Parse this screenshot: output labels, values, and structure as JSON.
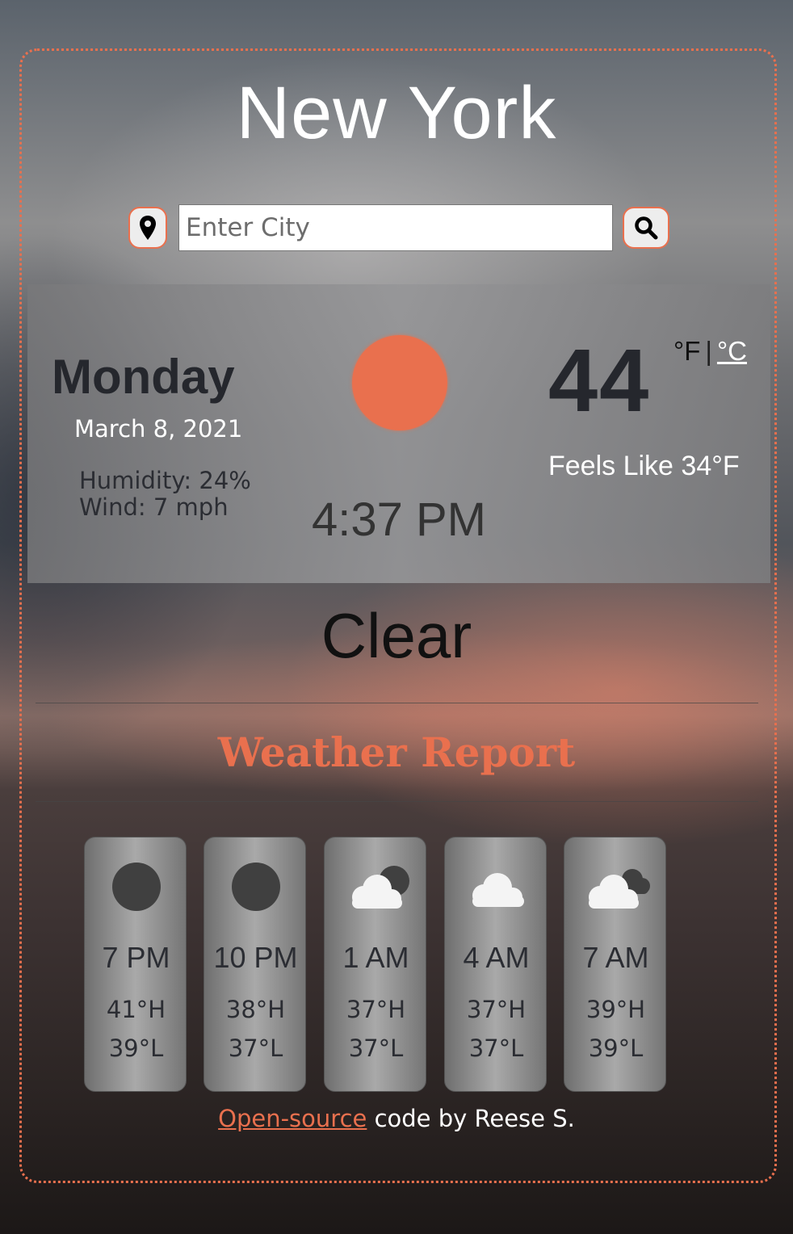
{
  "header": {
    "city": "New York"
  },
  "search": {
    "placeholder": "Enter City"
  },
  "current": {
    "day": "Monday",
    "date": "March 8, 2021",
    "humidity": "Humidity: 24%",
    "wind": "Wind: 7 mph",
    "time": "4:37 PM",
    "temperature": "44",
    "unit_f": "°F",
    "unit_separator": "|",
    "unit_c": "°C",
    "feels_like": "Feels Like 34°F",
    "description": "Clear",
    "icon": "sun-icon"
  },
  "report": {
    "title": "Weather Report"
  },
  "forecast": [
    {
      "hour": "7 PM",
      "high": "41°H",
      "low": "39°L",
      "icon": "moon-icon"
    },
    {
      "hour": "10 PM",
      "high": "38°H",
      "low": "37°L",
      "icon": "moon-icon"
    },
    {
      "hour": "1 AM",
      "high": "37°H",
      "low": "37°L",
      "icon": "cloud-moon-icon"
    },
    {
      "hour": "4 AM",
      "high": "37°H",
      "low": "37°L",
      "icon": "cloud-icon"
    },
    {
      "hour": "7 AM",
      "high": "39°H",
      "low": "39°L",
      "icon": "clouds-icon"
    }
  ],
  "footer": {
    "link": "Open-source",
    "text": " code by Reese S."
  },
  "colors": {
    "accent": "#e9704e",
    "dark_text": "#25272d"
  }
}
